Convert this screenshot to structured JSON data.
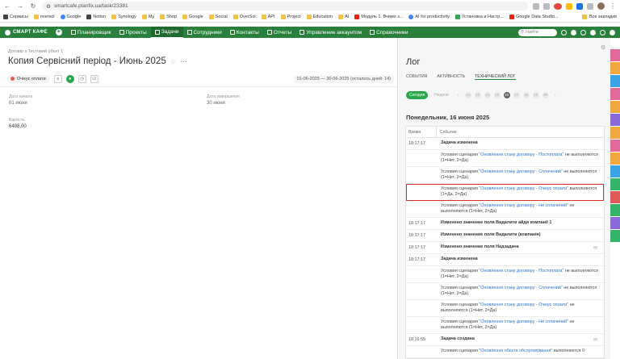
{
  "browser": {
    "url": "smartcafe.planfix.ua/task/23381",
    "bookmarks": [
      "Сервисы",
      "oversol",
      "Google",
      "Notion",
      "Synology",
      "My",
      "Shop",
      "Google",
      "Social",
      "OverSol",
      "API",
      "Project",
      "Education",
      "AI",
      "Модуль 1. Вчимо з...",
      "AI for productivity",
      "Установка и Настр...",
      "Google Data Studio..."
    ],
    "bookmarks_right": "Все закладки"
  },
  "topnav": {
    "logo": "СМАРТ КАФЕ",
    "items": [
      "Планировщик",
      "Проекты",
      "Задачи",
      "Сотрудники",
      "Контакты",
      "Отчеты",
      "Управление аккаунтом",
      "Справочники"
    ],
    "active_index": 2,
    "search_placeholder": "Найти"
  },
  "task": {
    "breadcrumb": "Договір з Тестовий обєкт 1",
    "title": "Копия Сервісний період - Июнь 2025",
    "status": "Очікує оплати",
    "period": "01-06-2025 — 30-06-2025 (осталось дней: 14)",
    "fields": {
      "start_label": "Дата начала",
      "start_value": "01 июня",
      "end_label": "Дата завершения",
      "end_value": "30 июня",
      "cost_label": "Вартість",
      "cost_value": "6498,00"
    }
  },
  "log": {
    "title": "Лог",
    "tabs": [
      "СОБЫТИЯ",
      "АКТИВНОСТЬ",
      "ТЕХНИЧЕСКИЙ ЛОГ"
    ],
    "active_tab": 2,
    "day_buttons": [
      "Сегодня",
      "Неделя"
    ],
    "numbers": [
      "12",
      "13",
      "14",
      "15",
      "16",
      "17",
      "18",
      "19",
      "20"
    ],
    "active_number": "16",
    "day_header": "Понедельник, 16 июня 2025",
    "col_time": "Время",
    "col_event": "Событие",
    "rows": [
      {
        "time": "18:17:17",
        "bold": true,
        "text": "Задача изменена"
      },
      {
        "time": "",
        "pre": "Условия сценария ",
        "link": "\"Оновлення стану договору - Постоплата\"",
        "post": " не выполняются (1=Нет, 2=Да)"
      },
      {
        "time": "",
        "pre": "Условия сценария ",
        "link": "\"Оновлення стану договору - Сплачений\"",
        "post": " не выполняются (1=Нет, 2=Да)"
      },
      {
        "time": "",
        "pre": "Условия сценария ",
        "link": "\"Оновлення стану договору - Очікує оплати\"",
        "post": " выполняются (1=Да, 2=Да)",
        "highlight": true
      },
      {
        "time": "",
        "pre": "Условия сценария ",
        "link": "\"Оновлення стану договору - Не сплачений\"",
        "post": " не выполняются (1=Нет, 2=Да)"
      },
      {
        "time": "18:17:17",
        "bold": true,
        "text": "Изменено значение поля Видалити айди компанії 1"
      },
      {
        "time": "18:17:17",
        "bold": true,
        "text": "Изменено значение поля Видалити (компанія)"
      },
      {
        "time": "18:17:17",
        "bold": true,
        "text": "Изменено значение поля Надзадача",
        "clip": true
      },
      {
        "time": "18:17:17",
        "bold": true,
        "text": "Задача изменена"
      },
      {
        "time": "",
        "pre": "Условия сценария ",
        "link": "\"Оновлення стану договору - Постоплата\"",
        "post": " не выполняются (1=Нет, 2=Да)"
      },
      {
        "time": "",
        "pre": "Условия сценария ",
        "link": "\"Оновлення стану договору - Сплачений\"",
        "post": " не выполняются (1=Нет, 2=Да)"
      },
      {
        "time": "",
        "pre": "Условия сценария ",
        "link": "\"Оновлення стану договору - Очікує оплати\"",
        "post": " не выполняются (1=Нет, 2=Да)"
      },
      {
        "time": "",
        "pre": "Условия сценария ",
        "link": "\"Оновлення стану договору - Не сплачений\"",
        "post": " не выполняются (1=Нет, 2=Да)"
      },
      {
        "time": "18:16:55",
        "bold": true,
        "text": "Задача создана",
        "clip": true
      },
      {
        "time": "",
        "pre": "Условия сценария ",
        "link": "\"Оновлення обєкта обслуговування\"",
        "post": " выполняются 0"
      }
    ]
  },
  "colors": {
    "brand_green": "#29803b",
    "highlight_red": "#d9302a",
    "link_blue": "#2a72c8",
    "rail": [
      "#e06b9b",
      "#f0a840",
      "#3aa3e3",
      "#e06b9b",
      "#f0a840",
      "#8a6ad8",
      "#f0a840",
      "#e06b9b",
      "#f0a840",
      "#3aa3e3",
      "#34b56a",
      "#e05a5a",
      "#34b56a",
      "#8a6ad8",
      "#34b56a"
    ]
  }
}
